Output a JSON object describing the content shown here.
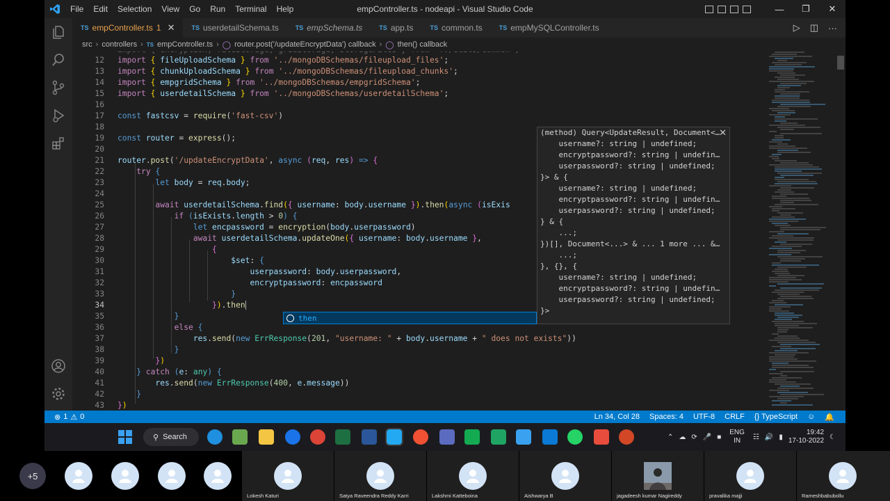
{
  "window": {
    "title": "empController.ts - nodeapi - Visual Studio Code",
    "menu": [
      "File",
      "Edit",
      "Selection",
      "View",
      "Go",
      "Run",
      "Terminal",
      "Help"
    ]
  },
  "tabs": [
    {
      "label": "empController.ts",
      "badge": "1",
      "italic": false,
      "active": true
    },
    {
      "label": "userdetailSchema.ts",
      "italic": false,
      "active": false
    },
    {
      "label": "empSchema.ts",
      "italic": true,
      "active": false
    },
    {
      "label": "app.ts",
      "italic": false,
      "active": false
    },
    {
      "label": "common.ts",
      "italic": false,
      "active": false
    },
    {
      "label": "empMySQLController.ts",
      "italic": false,
      "active": false
    }
  ],
  "tab_icon_text": "TS",
  "breadcrumb": [
    "src",
    "controllers",
    "empController.ts",
    "router.post('/updateEncryptData') callback",
    "then() callback"
  ],
  "hover_lines": [
    "(method) Query<UpdateResult, Document<…",
    "    username?: string | undefined;",
    "    encryptpassword?: string | undefin…",
    "    userpassword?: string | undefined;",
    "}> & {",
    "    username?: string | undefined;",
    "    encryptpassword?: string | undefin…",
    "    userpassword?: string | undefined;",
    "} & {",
    "    ...;",
    "})[], Document<...> & ... 1 more ... &…",
    "    ...;",
    "}, {}, {",
    "    username?: string | undefined;",
    "    encryptpassword?: string | undefin…",
    "    userpassword?: string | undefined;",
    "}>"
  ],
  "suggestion": "then",
  "status": {
    "errors": "1",
    "warnings": "0",
    "position": "Ln 34, Col 28",
    "spaces": "Spaces: 4",
    "encoding": "UTF-8",
    "eol": "CRLF",
    "language": "TypeScript"
  },
  "taskbar": {
    "search_label": "Search",
    "lang_top": "ENG",
    "lang_bottom": "IN",
    "time": "19:42",
    "date": "17-10-2022"
  },
  "participants": {
    "more": "+5",
    "names": [
      "Lokesh Katuri",
      "Satya Raveendra Reddy Karri",
      "Lakshmi Katteboina",
      "Aishwarya B",
      "jagadeesh kumar Nagireddy",
      "pravalika majji",
      "Rameshbabubollu"
    ]
  }
}
